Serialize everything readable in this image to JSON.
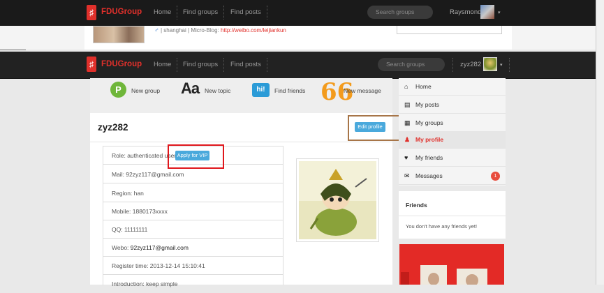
{
  "background_window": {
    "nav": {
      "logo_glyph": "♯",
      "brand": "FDUGroup",
      "links": [
        "Home",
        "Find groups",
        "Find posts"
      ],
      "search_placeholder": "Search groups",
      "username": "Raysmond",
      "caret": "▾"
    },
    "profile_info": {
      "gender_glyph": "♂",
      "location": "shanghai",
      "separator": "|",
      "microblog_label": "Micro-Blog:",
      "microblog_url": "http://weibo.com/leijiankun"
    }
  },
  "nav": {
    "logo_glyph": "♯",
    "brand": "FDUGroup",
    "links": [
      "Home",
      "Find groups",
      "Find posts"
    ],
    "search_placeholder": "Search groups",
    "username": "zyz282",
    "caret": "▾"
  },
  "actions": {
    "new_group": {
      "glyph": "P",
      "label": "New group"
    },
    "new_topic": {
      "glyph": "Aa",
      "label": "New topic"
    },
    "find_friends": {
      "glyph": "hi!",
      "label": "Find friends"
    },
    "new_message": {
      "glyph": "66",
      "label": "New message"
    }
  },
  "profile": {
    "username": "zyz282",
    "edit_button": "Edit profile",
    "apply_vip_button": "Apply for VIP",
    "fields": {
      "role": "Role: authenticated user",
      "mail": "Mail: 92zyz117@gmail.com",
      "region": "Region: han",
      "mobile": "Mobile: 1880173xxxx",
      "qq": "QQ: 11111111",
      "webo_label": "Webo: ",
      "webo_value": "92zyz117@gmail.com",
      "register": "Register time: 2013-12-14 15:10:41",
      "introduction": "Introduction: keep simple"
    }
  },
  "sidebar": {
    "items": [
      {
        "icon": "home-icon",
        "glyph": "⌂",
        "label": "Home"
      },
      {
        "icon": "posts-icon",
        "glyph": "▤",
        "label": "My posts"
      },
      {
        "icon": "groups-icon",
        "glyph": "▦",
        "label": "My groups"
      },
      {
        "icon": "user-icon",
        "glyph": "♟",
        "label": "My profile",
        "active": true
      },
      {
        "icon": "heart-icon",
        "glyph": "♥",
        "label": "My friends"
      },
      {
        "icon": "envelope-icon",
        "glyph": "✉",
        "label": "Messages",
        "badge": "1"
      }
    ]
  },
  "friends": {
    "title": "Friends",
    "empty_text": "You don't have any friends yet!"
  },
  "colors": {
    "brand_red": "#e0302b",
    "nav_bg": "#222222",
    "button_blue": "#4aa9dc",
    "annotation_red": "#e0171c",
    "annotation_brown": "#a77548",
    "badge_red": "#e84c3d"
  }
}
